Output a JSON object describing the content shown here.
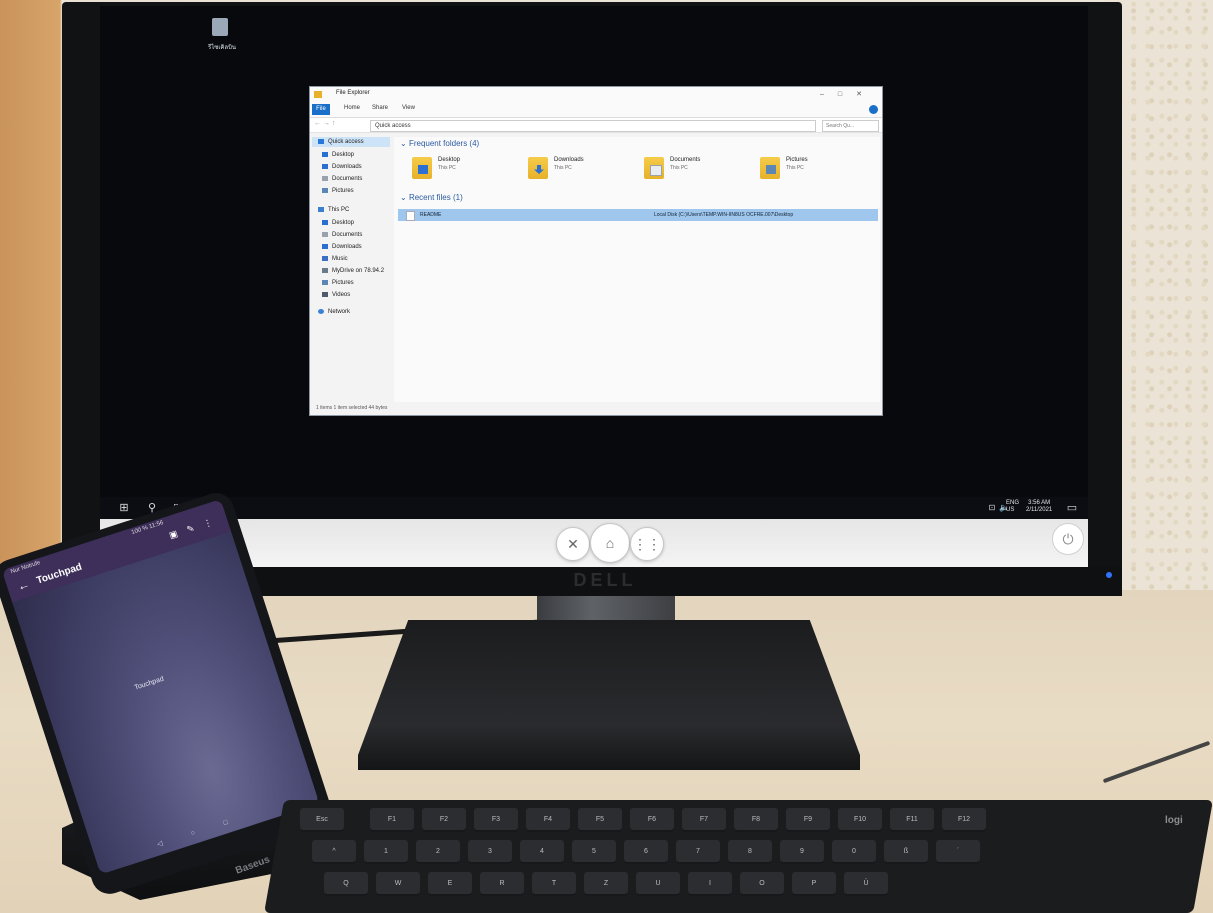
{
  "desktop": {
    "recycle_bin_label": "รีไซเคิลบิน"
  },
  "file_explorer": {
    "title": "File Explorer",
    "tabs": [
      "File",
      "Home",
      "Share",
      "View"
    ],
    "address": "Quick access",
    "search_placeholder": "Search Qu...",
    "nav": {
      "quick_access": "Quick access",
      "quick_items": [
        "Desktop",
        "Downloads",
        "Documents",
        "Pictures"
      ],
      "this_pc": "This PC",
      "pc_items": [
        "Desktop",
        "Documents",
        "Downloads",
        "Music",
        "MyDrive on 78.94.2",
        "Pictures",
        "Videos"
      ],
      "network": "Network"
    },
    "frequent_header": "Frequent folders (4)",
    "frequent_folders": [
      {
        "name": "Desktop",
        "location": "This PC"
      },
      {
        "name": "Downloads",
        "location": "This PC"
      },
      {
        "name": "Documents",
        "location": "This PC"
      },
      {
        "name": "Pictures",
        "location": "This PC"
      }
    ],
    "recent_header": "Recent files (1)",
    "recent_file": {
      "name": "README",
      "path": "Local Disk (C:)\\Users\\TEMP.WIN-IIN8US OCFRE.007\\Desktop"
    },
    "status": "1 items    1 item selected  44 bytes"
  },
  "taskbar": {
    "lang_top": "ENG",
    "lang_bottom": "US",
    "time": "3:56 AM",
    "date": "2/11/2021"
  },
  "monitor": {
    "brand": "DELL"
  },
  "phone": {
    "status_left": "Nur Notrufe",
    "status_right": "100 % 11:56",
    "title": "Touchpad",
    "touchpad_label": "Touchpad",
    "dock_brand": "Baseus"
  },
  "keyboard": {
    "brand": "logi",
    "row1": [
      "Esc",
      "F1",
      "F2",
      "F3",
      "F4",
      "F5",
      "F6",
      "F7",
      "F8",
      "F9",
      "F10",
      "F11",
      "F12"
    ],
    "row2": [
      "^",
      "1",
      "2",
      "3",
      "4",
      "5",
      "6",
      "7",
      "8",
      "9",
      "0",
      "ß",
      "´"
    ],
    "row3": [
      "Q",
      "W",
      "E",
      "R",
      "T",
      "Z",
      "U",
      "I",
      "O",
      "P",
      "Ü"
    ]
  }
}
